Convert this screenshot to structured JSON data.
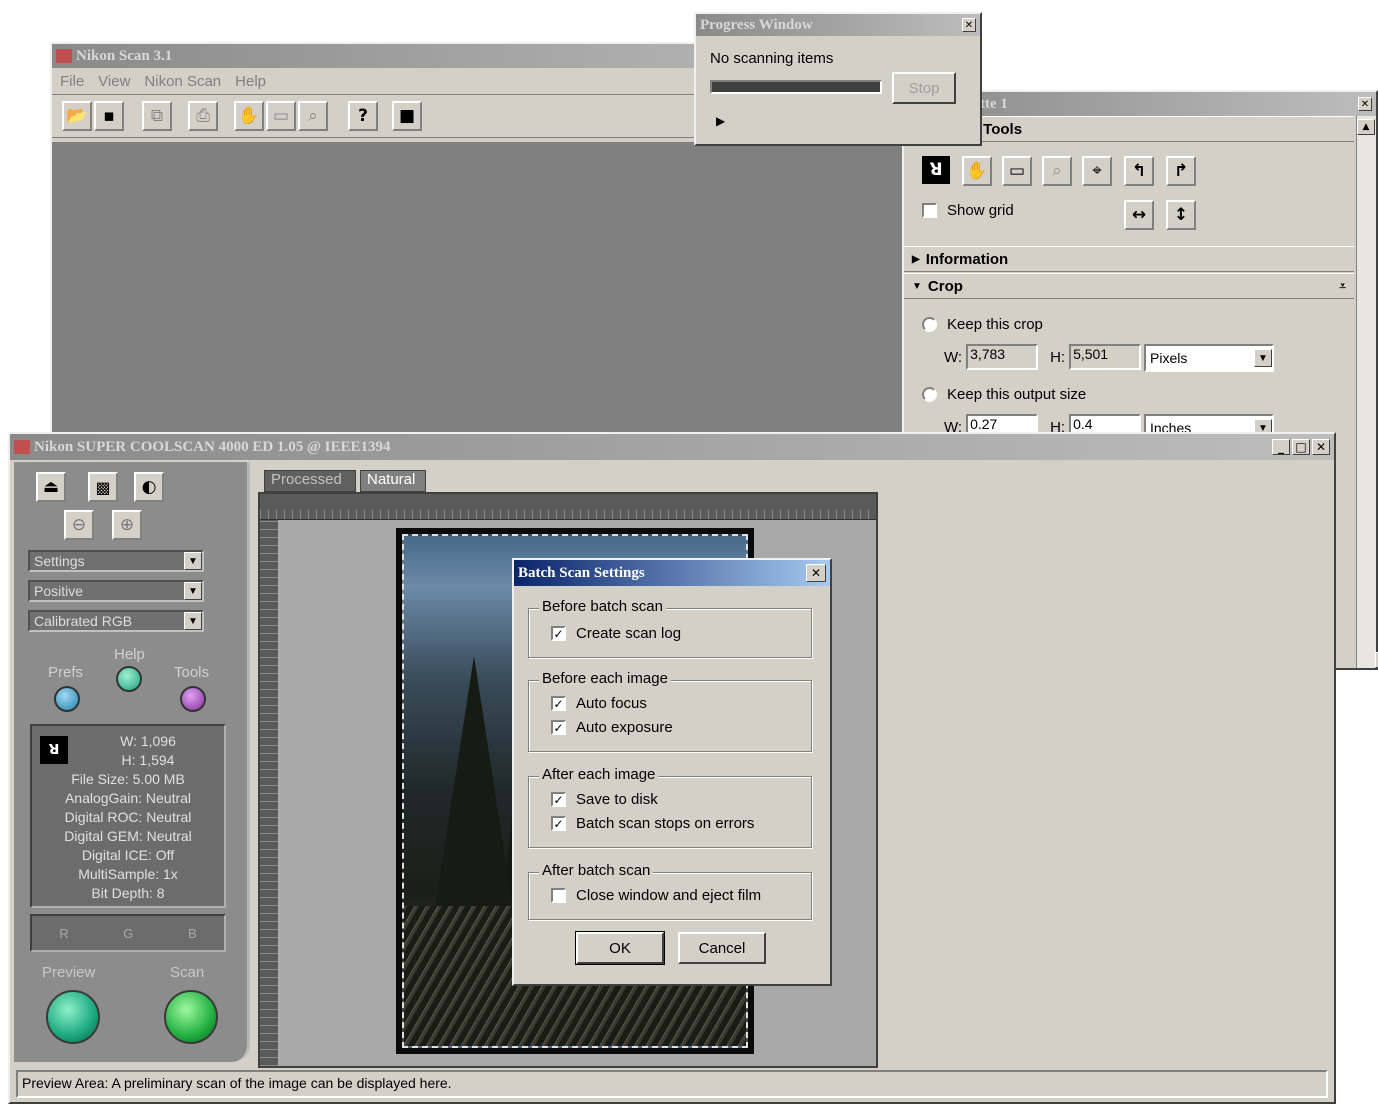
{
  "main_window": {
    "title": "Nikon Scan 3.1",
    "menu": [
      "File",
      "View",
      "Nikon Scan",
      "Help"
    ]
  },
  "progress_window": {
    "title": "Progress Window",
    "status": "No scanning items",
    "stop_label": "Stop",
    "progress": 1.0
  },
  "palette": {
    "title": "tte 1",
    "tools_header": "t Tools",
    "show_grid_label": "Show grid",
    "information_label": "Information",
    "crop_label": "Crop",
    "keep_crop_label": "Keep this crop",
    "crop_w_label": "W:",
    "crop_w": "3,783",
    "crop_h_label": "H:",
    "crop_h": "5,501",
    "crop_unit": "Pixels",
    "keep_output_label": "Keep this output size",
    "out_w_label": "W:",
    "out_w": "0.27",
    "out_h_label": "H:",
    "out_h": "0.4",
    "out_unit": "Inches"
  },
  "scanner_window": {
    "title": "Nikon SUPER COOLSCAN 4000 ED 1.05 @ IEEE1394",
    "tabs": [
      "Processed",
      "Natural"
    ],
    "dropdowns": [
      "Settings",
      "Positive",
      "Calibrated RGB"
    ],
    "prefs_label": "Prefs",
    "help_label": "Help",
    "tools_label": "Tools",
    "info_w": "W: 1,096",
    "info_h": "H: 1,594",
    "file_size": "File Size: 5.00 MB",
    "analog_gain": "AnalogGain: Neutral",
    "digital_roc": "Digital ROC: Neutral",
    "digital_gem": "Digital GEM: Neutral",
    "digital_ice": "Digital ICE: Off",
    "multisample": "MultiSample: 1x",
    "bit_depth": "Bit Depth: 8",
    "rgb": [
      "R",
      "G",
      "B"
    ],
    "preview_label": "Preview",
    "scan_label": "Scan",
    "status_bar": "Preview Area: A preliminary scan of the image can be displayed here."
  },
  "dialog": {
    "title": "Batch Scan Settings",
    "close": "✕",
    "groups": [
      {
        "label": "Before batch scan",
        "items": [
          {
            "label": "Create scan log",
            "checked": true
          }
        ]
      },
      {
        "label": "Before each image",
        "items": [
          {
            "label": "Auto focus",
            "checked": true
          },
          {
            "label": "Auto exposure",
            "checked": true
          }
        ]
      },
      {
        "label": "After each image",
        "items": [
          {
            "label": "Save to disk",
            "checked": true
          },
          {
            "label": "Batch scan stops on errors",
            "checked": true
          }
        ]
      },
      {
        "label": "After batch scan",
        "items": [
          {
            "label": "Close window and eject film",
            "checked": false
          }
        ]
      }
    ],
    "ok_label": "OK",
    "cancel_label": "Cancel"
  }
}
